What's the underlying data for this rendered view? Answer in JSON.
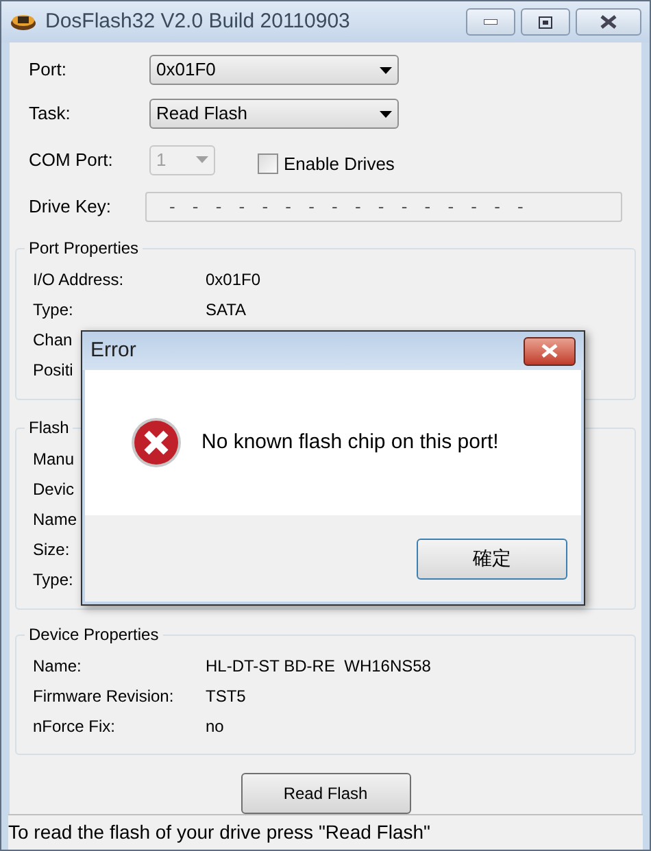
{
  "window": {
    "title": "DosFlash32 V2.0 Build 20110903"
  },
  "form": {
    "port": {
      "label": "Port:",
      "value": "0x01F0"
    },
    "task": {
      "label": "Task:",
      "value": "Read Flash"
    },
    "com_port": {
      "label": "COM Port:",
      "value": "1",
      "disabled": true
    },
    "enable_drives": {
      "label": "Enable Drives",
      "checked": false
    },
    "drive_key": {
      "label": "Drive Key:",
      "value": "- - - - - - - - - - - - - - - -",
      "disabled": true
    }
  },
  "groups": [
    {
      "title": "Port Properties",
      "rows": [
        {
          "label": "I/O Address:",
          "value": "0x01F0"
        },
        {
          "label": "Type:",
          "value": "SATA"
        },
        {
          "label": "Chan"
        },
        {
          "label": "Positi"
        }
      ]
    },
    {
      "title": "Flash",
      "rows": [
        {
          "label": "Manu"
        },
        {
          "label": "Devic"
        },
        {
          "label": "Name"
        },
        {
          "label": "Size:"
        },
        {
          "label": "Type:"
        }
      ]
    },
    {
      "title": "Device Properties",
      "rows": [
        {
          "label": "Name:",
          "value": "HL-DT-ST BD-RE  WH16NS58"
        },
        {
          "label": "Firmware Revision:",
          "value": "TST5"
        },
        {
          "label": "nForce Fix:",
          "value": "no"
        }
      ]
    }
  ],
  "action_button": "Read Flash",
  "status_bar": "To read the flash of your drive press \"Read Flash\"",
  "dialog": {
    "title": "Error",
    "message": "No known flash chip on this port!",
    "button": "確定"
  }
}
